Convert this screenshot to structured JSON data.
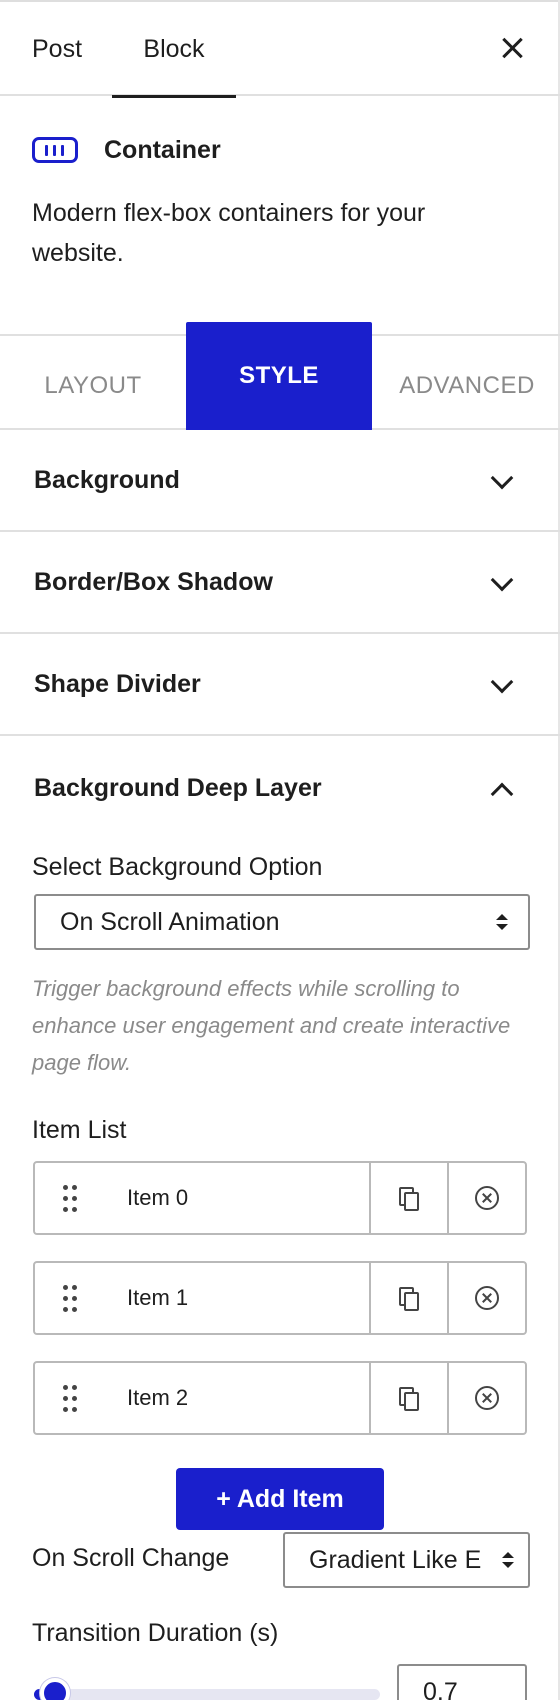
{
  "header": {
    "tabs": [
      {
        "label": "Post",
        "active": false
      },
      {
        "label": "Block",
        "active": true
      }
    ],
    "close_icon": "close-icon"
  },
  "block": {
    "icon": "container-columns-icon",
    "title": "Container",
    "description": "Modern flex-box containers for your website."
  },
  "style_tabs": [
    {
      "label": "LAYOUT",
      "active": false
    },
    {
      "label": "STYLE",
      "active": true
    },
    {
      "label": "ADVANCED",
      "active": false
    }
  ],
  "panels": [
    {
      "label": "Background",
      "expanded": false
    },
    {
      "label": "Border/Box Shadow",
      "expanded": false
    },
    {
      "label": "Shape Divider",
      "expanded": false
    },
    {
      "label": "Background Deep Layer",
      "expanded": true
    }
  ],
  "deep_layer": {
    "select_label": "Select Background Option",
    "select_value": "On Scroll Animation",
    "help_text": "Trigger background effects while scrolling to enhance user engagement and create interactive page flow.",
    "item_list_label": "Item List",
    "items": [
      {
        "label": "Item 0"
      },
      {
        "label": "Item 1"
      },
      {
        "label": "Item 2"
      }
    ],
    "add_item_label": "+ Add Item",
    "scroll_change_label": "On Scroll Change",
    "scroll_change_value": "Gradient Like E",
    "transition_label": "Transition Duration (s)",
    "transition_value": "0.7",
    "transition_fraction": 0.06
  },
  "colors": {
    "accent": "#1a1fcc",
    "text": "#1e1e1e",
    "muted": "#8a8a8a",
    "border": "#e0e0e0"
  }
}
